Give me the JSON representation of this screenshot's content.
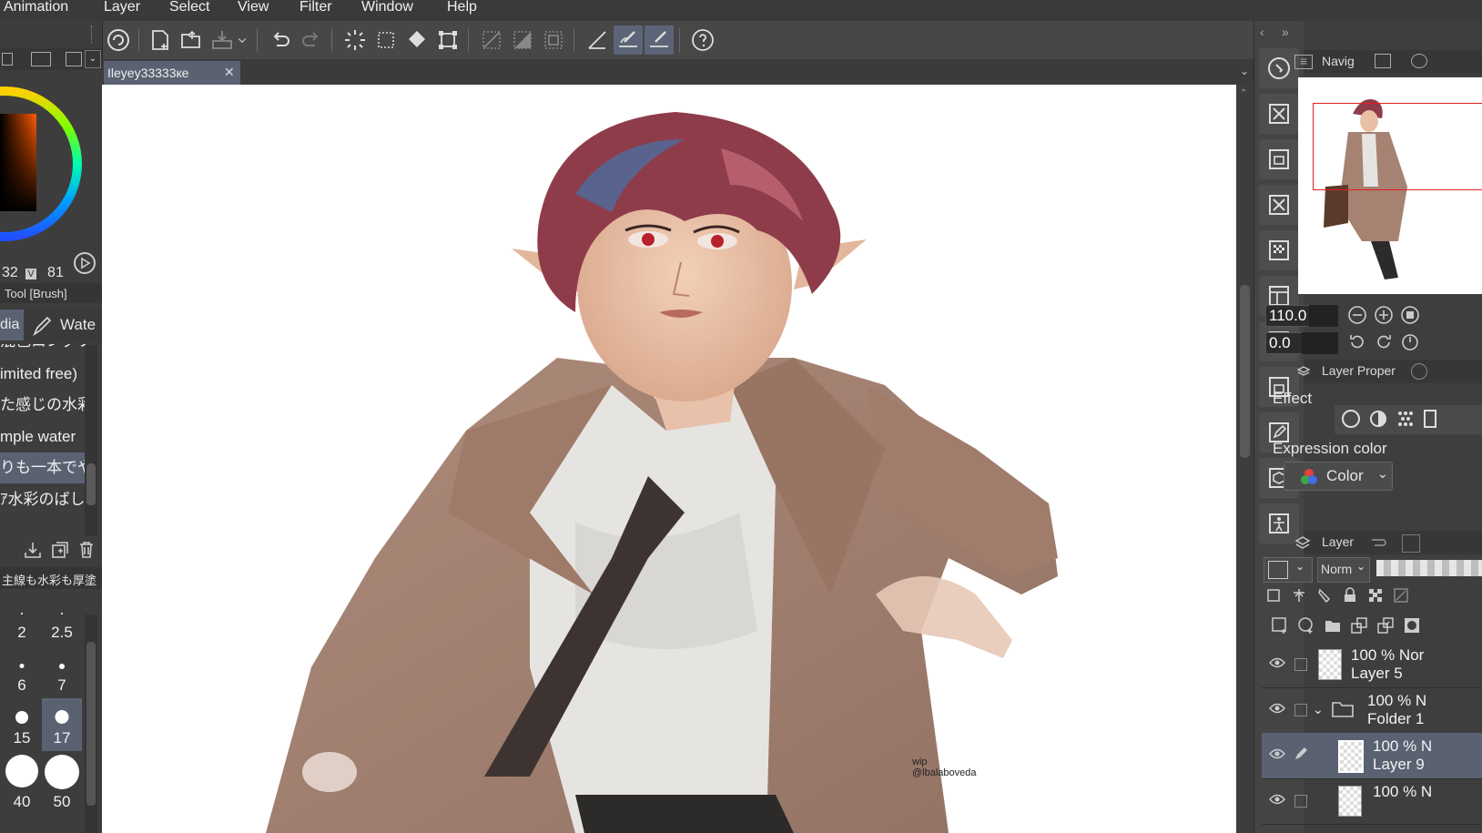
{
  "menu": [
    "Animation",
    "Layer",
    "Select",
    "View",
    "Filter",
    "Window",
    "Help"
  ],
  "document_tab": {
    "title": "Ileyey33333кe",
    "close": "✕"
  },
  "color_panel": {
    "s_value": "32",
    "v_label": "V",
    "v_value": "81"
  },
  "tool_panel": {
    "title": "Tool [Brush]",
    "subtool_tabs": [
      "dia",
      "Wate"
    ],
    "brushes": [
      "混色ロングブ",
      "imited free)",
      "た感じの水彩",
      "mple water",
      "りも一本でや",
      "ｱ水彩のばし"
    ],
    "brush_selected_index": 4,
    "preset_label": "主線も水彩も厚塗"
  },
  "brush_sizes": [
    {
      "label": "2",
      "size": 2
    },
    {
      "label": "2.5",
      "size": 2.5
    },
    {
      "label": "6",
      "size": 6
    },
    {
      "label": "7",
      "size": 7
    },
    {
      "label": "15",
      "size": 15
    },
    {
      "label": "17",
      "size": 17,
      "selected": true
    },
    {
      "label": "40",
      "size": 40
    },
    {
      "label": "50",
      "size": 50
    }
  ],
  "artwork": {
    "watermark_line1": "wip",
    "watermark_line2": "@lbalaboveda"
  },
  "navigator": {
    "tab_label": "Navig",
    "zoom": "110.0",
    "rotation": "0.0"
  },
  "layer_property": {
    "tab_label": "Layer Proper",
    "effect_label": "Effect",
    "expression_color_label": "Expression color",
    "expression_color_value": "Color"
  },
  "layer_panel": {
    "tab_label": "Layer",
    "blend_mode": "Norm",
    "layers": [
      {
        "opacity": "100 % Nor",
        "name": "Layer 5",
        "type": "raster"
      },
      {
        "opacity": "100 % N",
        "name": "Folder 1",
        "type": "folder"
      },
      {
        "opacity": "100 % N",
        "name": "Layer 9",
        "type": "raster",
        "selected": true
      },
      {
        "opacity": "100 % N",
        "name": "",
        "type": "raster"
      }
    ]
  },
  "colors": {
    "accent_selection": "#5a6272",
    "main_color": "#c45a1f",
    "navigator_frame": "#e02020"
  }
}
